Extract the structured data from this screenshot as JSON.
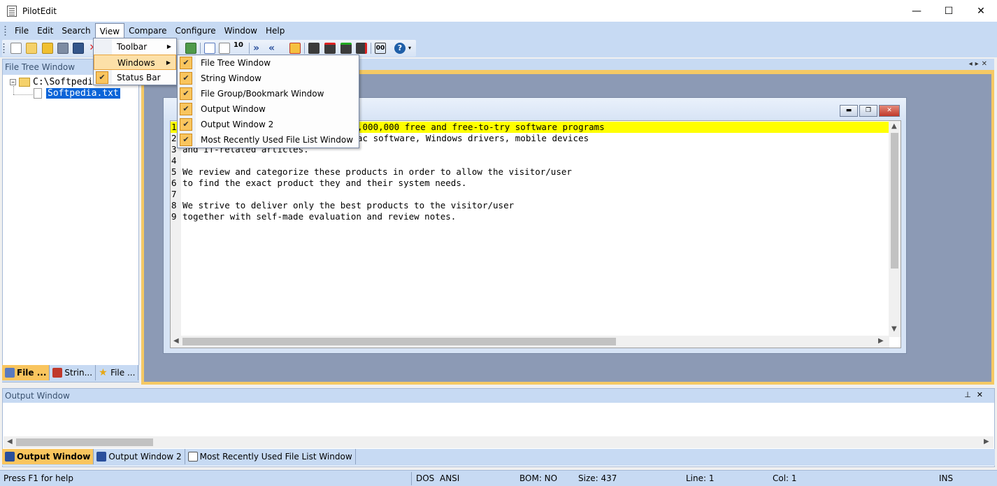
{
  "app": {
    "title": "PilotEdit",
    "controls": {
      "minimize": "—",
      "maximize": "☐",
      "close": "✕"
    }
  },
  "menubar": {
    "items": [
      "File",
      "Edit",
      "Search",
      "View",
      "Compare",
      "Configure",
      "Window",
      "Help"
    ],
    "active": "View"
  },
  "view_menu": {
    "items": [
      {
        "label": "Toolbar",
        "has_submenu": true,
        "checked": false
      },
      {
        "label": "Windows",
        "has_submenu": true,
        "checked": false,
        "highlighted": true
      },
      {
        "label": "Status Bar",
        "has_submenu": false,
        "checked": true
      }
    ]
  },
  "windows_submenu": {
    "items": [
      {
        "label": "File Tree Window",
        "checked": true
      },
      {
        "label": "String Window",
        "checked": true
      },
      {
        "label": "File Group/Bookmark Window",
        "checked": true
      },
      {
        "label": "Output Window",
        "checked": true
      },
      {
        "label": "Output Window 2",
        "checked": true
      },
      {
        "label": "Most Recently Used File List Window",
        "checked": true
      }
    ]
  },
  "file_tree": {
    "title": "File Tree Window",
    "root": "C:\\Softpedia",
    "child": "Softpedia.txt",
    "tabs": [
      "File ...",
      "Strin...",
      "File ..."
    ]
  },
  "editor": {
    "lines": [
      {
        "num": "1",
        "text": "Softpedia is a library of over 1,000,000 free and free-to-try software programs",
        "visible": ",000,000 free and free-to-try software programs"
      },
      {
        "num": "2",
        "text": "for Windows and Unix/Linux, games, Mac software, Windows drivers, mobile devices",
        "visible": "ac software, Windows drivers, mobile devices"
      },
      {
        "num": "3",
        "text": "and IT-related articles.",
        "visible": "and IT-related articles."
      },
      {
        "num": "4",
        "text": ""
      },
      {
        "num": "5",
        "text": "We review and categorize these products in order to allow the visitor/user"
      },
      {
        "num": "6",
        "text": "to find the exact product they and their system needs."
      },
      {
        "num": "7",
        "text": ""
      },
      {
        "num": "8",
        "text": "We strive to deliver only the best products to the visitor/user"
      },
      {
        "num": "9",
        "text": "together with self-made evaluation and review notes."
      }
    ]
  },
  "output": {
    "title": "Output Window",
    "tabs": [
      "Output Window",
      "Output Window 2",
      "Most Recently Used File List Window"
    ]
  },
  "statusbar": {
    "help": "Press F1 for help",
    "eol": "DOS",
    "encoding": "ANSI",
    "bom": "BOM: NO",
    "size": "Size: 437",
    "line": "Line: 1",
    "col": "Col: 1",
    "mode": "INS"
  },
  "colors": {
    "chrome": "#c7daf3",
    "accent": "#f9c55e",
    "line_highlight": "#ffff00",
    "selection": "#0a64d8"
  }
}
